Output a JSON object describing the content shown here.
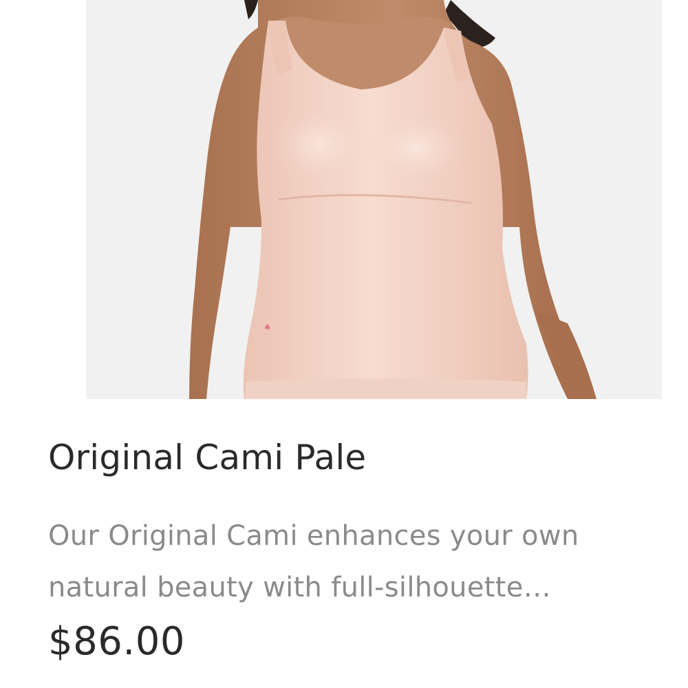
{
  "product": {
    "image_alt": "Woman wearing pale pink shaping camisole",
    "title": "Original Cami Pale",
    "description": "Our Original Cami enhances your own natural beauty with full-silhouette…",
    "price": "$86.00"
  },
  "colors": {
    "image_background": "#f1f1f1",
    "garment": "#f3d3c7",
    "skin": "#b98463",
    "hair": "#2b221e",
    "title_text": "#2a2a2a",
    "description_text": "#8a8a8a"
  }
}
